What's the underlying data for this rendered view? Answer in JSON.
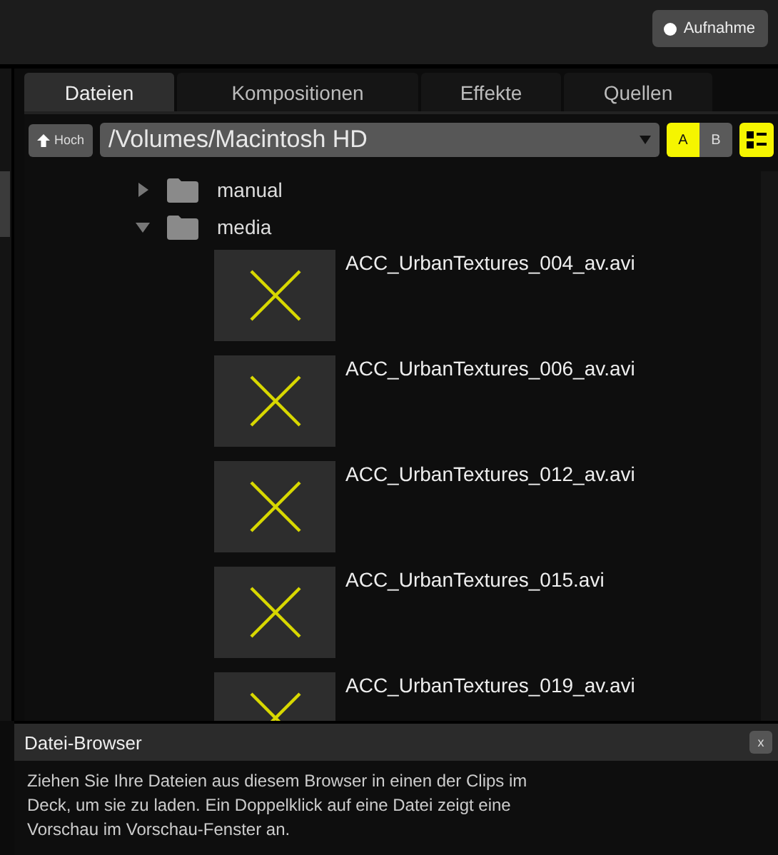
{
  "record_button": {
    "label": "Aufnahme"
  },
  "tabs": [
    {
      "label": "Dateien",
      "selected": true
    },
    {
      "label": "Kompositionen",
      "selected": false
    },
    {
      "label": "Effekte",
      "selected": false
    },
    {
      "label": "Quellen",
      "selected": false
    }
  ],
  "toolbar": {
    "up_button": "Hoch",
    "path": "/Volumes/Macintosh HD",
    "deck_toggle": [
      {
        "label": "A",
        "selected": true
      },
      {
        "label": "B",
        "selected": false
      }
    ]
  },
  "tree": [
    {
      "kind": "folder",
      "name": "manual",
      "expanded": false
    },
    {
      "kind": "folder",
      "name": "media",
      "expanded": true,
      "children": [
        {
          "kind": "file",
          "name": "ACC_UrbanTextures_004_av.avi"
        },
        {
          "kind": "file",
          "name": "ACC_UrbanTextures_006_av.avi"
        },
        {
          "kind": "file",
          "name": "ACC_UrbanTextures_012_av.avi"
        },
        {
          "kind": "file",
          "name": "ACC_UrbanTextures_015.avi"
        },
        {
          "kind": "file",
          "name": "ACC_UrbanTextures_019_av.avi"
        }
      ]
    }
  ],
  "info_panel": {
    "title": "Datei-Browser",
    "close": "x",
    "text": "Ziehen Sie Ihre Dateien aus diesem Browser in einen der Clips im Deck, um sie zu laden. Ein Doppelklick auf eine Datei zeigt eine Vorschau im Vorschau-Fenster an."
  }
}
